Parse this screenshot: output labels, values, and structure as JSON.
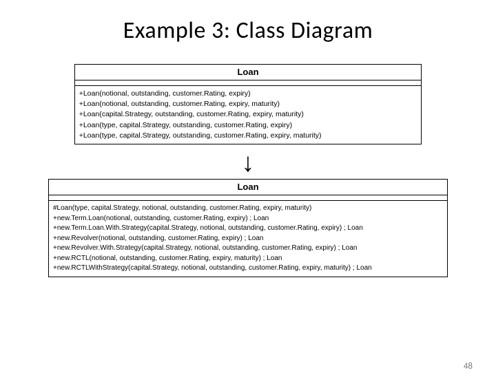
{
  "slide": {
    "title": "Example 3: Class Diagram",
    "page_number": "48"
  },
  "arrow": "↓",
  "before": {
    "name": "Loan",
    "operations": [
      "+Loan(notional, outstanding, customer.Rating, expiry)",
      "+Loan(notional, outstanding, customer.Rating, expiry, maturity)",
      "+Loan(capital.Strategy, outstanding, customer.Rating, expiry, maturity)",
      "+Loan(type, capital.Strategy, outstanding, customer.Rating, expiry)",
      "+Loan(type, capital.Strategy, outstanding, customer.Rating, expiry, maturity)"
    ]
  },
  "after": {
    "name": "Loan",
    "operations": [
      "#Loan(type, capital.Strategy, notional, outstanding, customer.Rating, expiry, maturity)",
      "+new.Term.Loan(notional, outstanding, customer.Rating, expiry) ; Loan",
      "+new.Term.Loan.With.Strategy(capital.Strategy, notional, outstanding, customer.Rating, expiry) ; Loan",
      "+new.Revolver(notional, outstanding, customer.Rating, expiry) ; Loan",
      "+new.Revolver.With.Strategy(capital.Strategy, notional, outstanding, customer.Rating, expiry) ; Loan",
      "+new.RCTL(notional, outstanding, customer.Rating, expiry, maturity) ; Loan",
      "+new.RCTLWithStrategy(capital.Strategy, notional, outstanding, customer.Rating, expiry, maturity) ; Loan"
    ]
  }
}
